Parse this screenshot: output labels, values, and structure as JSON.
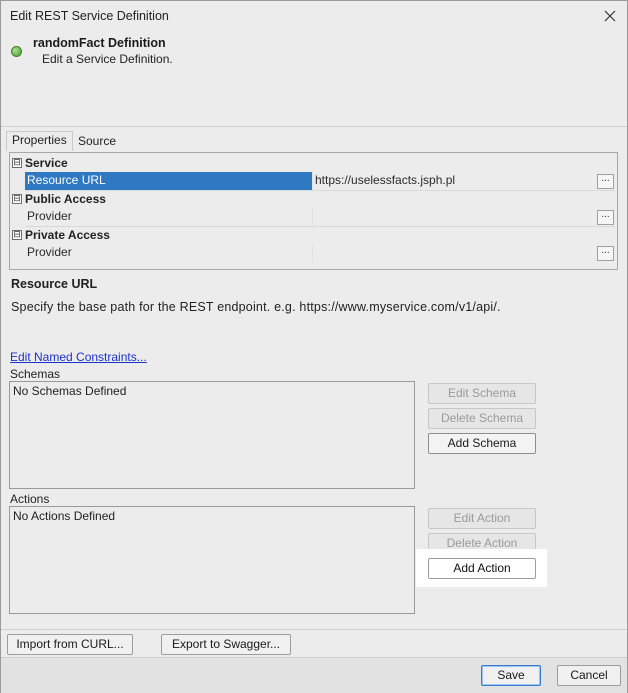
{
  "window": {
    "title": "Edit REST Service Definition"
  },
  "header": {
    "title": "randomFact Definition",
    "subtitle": "Edit a Service Definition."
  },
  "tabs": [
    {
      "label": "Properties"
    },
    {
      "label": "Source"
    }
  ],
  "property_grid": {
    "categories": [
      {
        "label": "Service",
        "rows": [
          {
            "name": "Resource URL",
            "value": "https://uselessfacts.jsph.pl",
            "selected": true
          }
        ]
      },
      {
        "label": "Public Access",
        "rows": [
          {
            "name": "Provider",
            "value": ""
          }
        ]
      },
      {
        "label": "Private Access",
        "rows": [
          {
            "name": "Provider",
            "value": ""
          }
        ]
      }
    ],
    "expander_symbol": "⊟",
    "ellipsis_symbol": "..."
  },
  "description": {
    "title": "Resource URL",
    "text": "Specify the base path for the REST endpoint. e.g. https://www.myservice.com/v1/api/."
  },
  "edit_constraints_link": "Edit Named Constraints...",
  "schemas": {
    "label": "Schemas",
    "empty_text": "No Schemas Defined",
    "buttons": {
      "edit": "Edit Schema",
      "delete": "Delete Schema",
      "add": "Add Schema"
    }
  },
  "actions": {
    "label": "Actions",
    "empty_text": "No Actions Defined",
    "buttons": {
      "edit": "Edit Action",
      "delete": "Delete Action",
      "add": "Add Action"
    }
  },
  "import_curl_label": "Import from CURL...",
  "export_swagger_label": "Export to Swagger...",
  "footer": {
    "save_label": "Save",
    "cancel_label": "Cancel"
  },
  "colors": {
    "selection": "#2f78c2",
    "status_ok": "#4f9a36",
    "link": "#1a33cc",
    "focus_border": "#3a7ad0"
  },
  "icons": {
    "close": "close-icon",
    "status": "status-dot-icon"
  }
}
